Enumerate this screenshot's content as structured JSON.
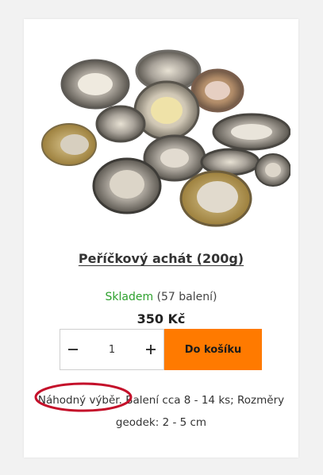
{
  "product": {
    "title": "Peříčkový achát (200g)",
    "stock_status": "Skladem",
    "stock_count": "(57 balení)",
    "price": "350 Kč",
    "quantity": "1",
    "add_to_cart_label": "Do košíku",
    "description_highlight": "Náhodný výběr",
    "description_rest": ". Balení cca 8 - 14 ks; Rozměry geodek: 2 - 5 cm"
  },
  "icons": {
    "decrement": "minus-icon",
    "increment": "plus-icon"
  },
  "colors": {
    "accent": "#ff7a00",
    "stock": "#2ea12e",
    "annotation": "#c4102a"
  }
}
